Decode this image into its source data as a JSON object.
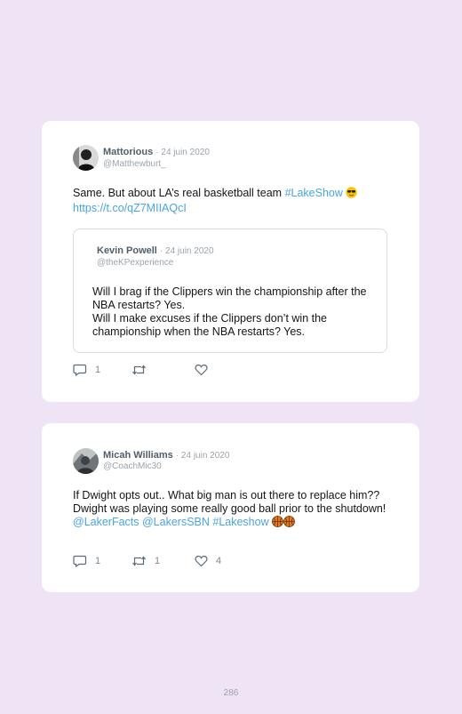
{
  "tweets": [
    {
      "author": "Mattorious",
      "date": "· 24 juin 2020",
      "handle": "@Matthewburt_",
      "text": "Same. But about LA’s real basketball team ",
      "hashtag": "#LakeShow",
      "link": "https://t.co/qZ7MIIAQcI",
      "emoji_icons": [
        "sunglasses-face-emoji"
      ],
      "quoted": {
        "author": "Kevin Powell",
        "date": "· 24 juin 2020",
        "handle": "@theKPexperience",
        "line1": "Will I brag if the Clippers win the championship after the NBA restarts? Yes.",
        "line2": "Will I make excuses if the Clippers don’t win the championship when the NBA restarts? Yes."
      },
      "actions": {
        "replies": "1",
        "retweets": "",
        "likes": ""
      }
    },
    {
      "author": "Micah Williams",
      "date": "· 24 juin 2020",
      "handle": "@CoachMic30",
      "text": "If Dwight opts out.. What big man is out there to replace him?? Dwight was playing some really good ball prior to the shutdown! ",
      "mentions": "@LakerFacts @LakersSBN #Lakeshow",
      "emoji_icons": [
        "basketball-emoji",
        "basketball-emoji"
      ],
      "actions": {
        "replies": "1",
        "retweets": "1",
        "likes": "4"
      }
    }
  ],
  "page_number": "286",
  "colors": {
    "background": "#efe3f6",
    "link": "#4aa4e0",
    "muted": "#9aa3ab"
  }
}
